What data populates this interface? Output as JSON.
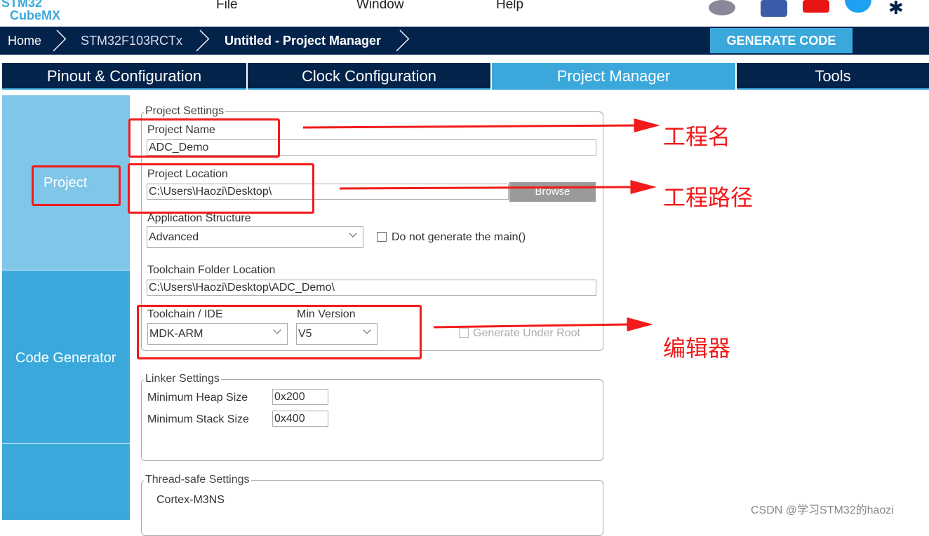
{
  "app": {
    "logo_top": "STM32",
    "logo_bottom": "CubeMX"
  },
  "menu": [
    "File",
    "Window",
    "Help"
  ],
  "social_icons": [
    "anniversary-badge-icon",
    "facebook-icon",
    "youtube-icon",
    "twitter-icon",
    "network-icon"
  ],
  "breadcrumb": [
    "Home",
    "STM32F103RCTx",
    "Untitled - Project Manager"
  ],
  "generate_label": "GENERATE CODE",
  "tabs": [
    "Pinout & Configuration",
    "Clock Configuration",
    "Project Manager",
    "Tools"
  ],
  "active_tab": "Project Manager",
  "sidebar": [
    "Project",
    "Code Generator"
  ],
  "project_settings": {
    "legend": "Project Settings",
    "name_label": "Project Name",
    "name_value": "ADC_Demo",
    "location_label": "Project Location",
    "location_value": "C:\\Users\\Haozi\\Desktop\\",
    "browse_label": "Browse",
    "structure_label": "Application Structure",
    "structure_value": "Advanced",
    "no_main_label": "Do not generate the main()",
    "toolchain_folder_label": "Toolchain Folder Location",
    "toolchain_folder_value": "C:\\Users\\Haozi\\Desktop\\ADC_Demo\\",
    "toolchain_label": "Toolchain / IDE",
    "toolchain_value": "MDK-ARM",
    "minver_label": "Min Version",
    "minver_value": "V5",
    "gen_root_label": "Generate Under Root"
  },
  "linker": {
    "legend": "Linker Settings",
    "heap_label": "Minimum Heap Size",
    "heap_value": "0x200",
    "stack_label": "Minimum Stack Size",
    "stack_value": "0x400"
  },
  "thread": {
    "legend": "Thread-safe Settings",
    "core": "Cortex-M3NS"
  },
  "annotations": [
    "工程名",
    "工程路径",
    "编辑器"
  ],
  "watermark": "CSDN @学习STM32的haozi",
  "colors": {
    "navy": "#03234b",
    "accent": "#3aa8db",
    "annotation": "#f21a1a"
  }
}
